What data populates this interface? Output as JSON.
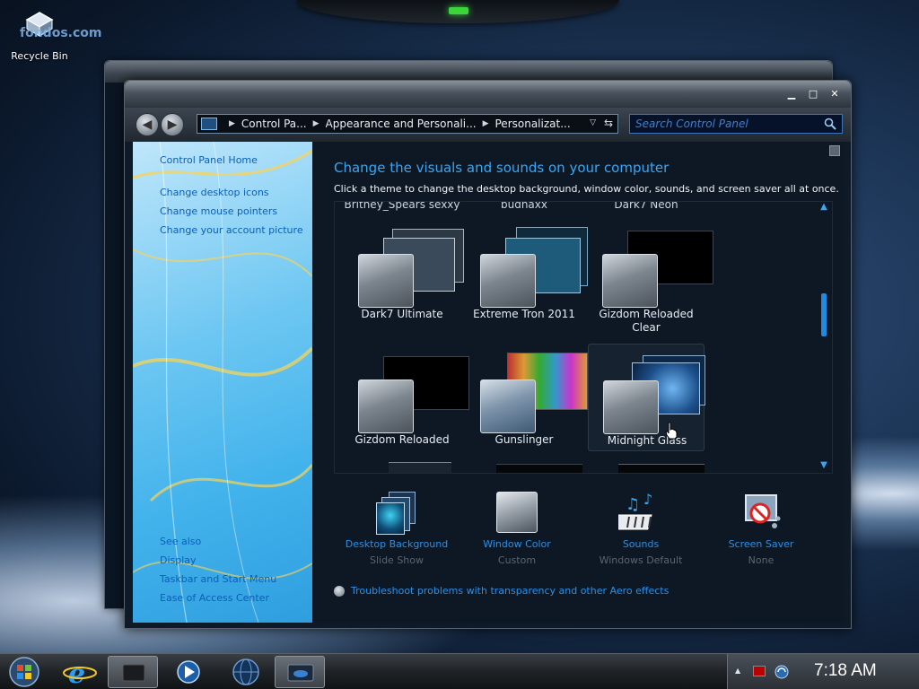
{
  "desktop": {
    "watermark": "fondos.com",
    "recycle_bin_label": "Recycle Bin"
  },
  "window": {
    "controls": {
      "minimize": "▁",
      "maximize": "□",
      "close": "✕"
    },
    "nav": {
      "back_glyph": "◀",
      "forward_glyph": "▶",
      "breadcrumbs": [
        "Control Pa...",
        "Appearance and Personali...",
        "Personalizat..."
      ],
      "crumb_separator": "▶",
      "dropdown_glyph": "▽",
      "refresh_glyph": "⇆",
      "search_placeholder": "Search Control Panel"
    },
    "left_pane": {
      "home_link": "Control Panel Home",
      "links": [
        "Change desktop icons",
        "Change mouse pointers",
        "Change your account picture"
      ],
      "see_also_label": "See also",
      "see_also_links": [
        "Display",
        "Taskbar and Start Menu",
        "Ease of Access Center"
      ]
    },
    "content": {
      "heading": "Change the visuals and sounds on your computer",
      "subtext": "Click a theme to change the desktop background, window color, sounds, and screen saver all at once.",
      "partial_row_names": [
        "Britney_Spears sexxy",
        "budnaxx",
        "Dark7 Neon"
      ],
      "themes": [
        {
          "name": "Dark7 Ultimate",
          "thumb_color": "#3a4a5a"
        },
        {
          "name": "Extreme Tron 2011",
          "thumb_color": "#1e5b7a"
        },
        {
          "name": "Gizdom Reloaded Clear",
          "thumb_color": "#000000"
        },
        {
          "name": "Gizdom Reloaded",
          "thumb_color": "#000000"
        },
        {
          "name": "Gunslinger",
          "thumb_color": "#7a4a1a"
        },
        {
          "name": "Midnight Glass",
          "thumb_color": "#1c4f8a"
        }
      ],
      "scroll_up_glyph": "▲",
      "scroll_down_glyph": "▼",
      "bottom_items": [
        {
          "label": "Desktop Background",
          "sub": "Slide Show"
        },
        {
          "label": "Window Color",
          "sub": "Custom"
        },
        {
          "label": "Sounds",
          "sub": "Windows Default"
        },
        {
          "label": "Screen Saver",
          "sub": "None"
        }
      ],
      "trouble_link": "Troubleshoot problems with transparency and other Aero effects"
    }
  },
  "taskbar": {
    "tray_arrow": "▲",
    "clock": "7:18 AM"
  },
  "colors": {
    "accent_blue": "#3ba6f0",
    "link_blue": "#2a8fe8",
    "left_pane_link": "#0b5fb8",
    "tray_flag": "#bb0000"
  }
}
